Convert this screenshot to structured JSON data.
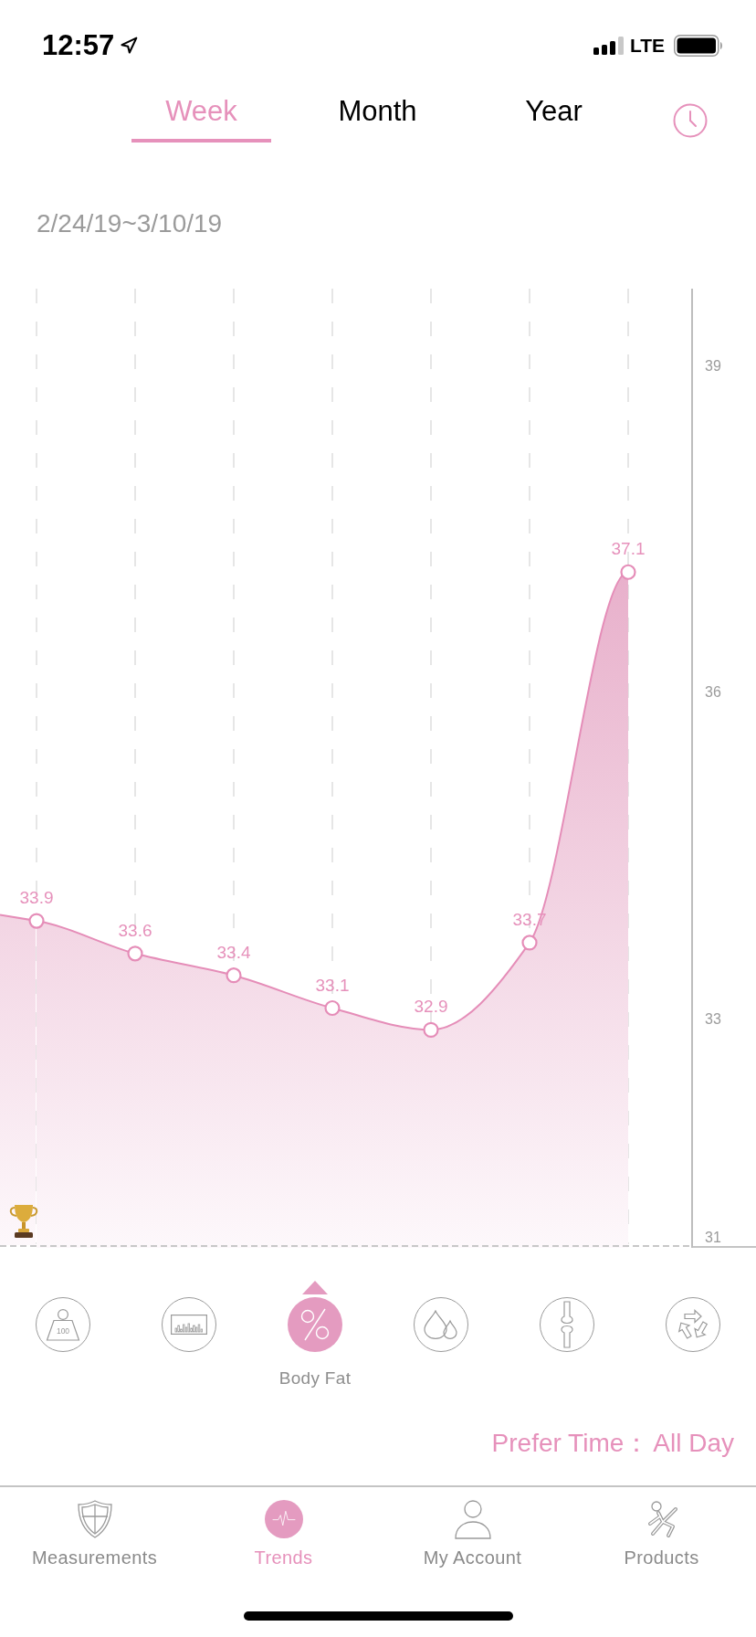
{
  "status_bar": {
    "time": "12:57",
    "network": "LTE"
  },
  "period_tabs": [
    {
      "label": "Week",
      "selected": true
    },
    {
      "label": "Month",
      "selected": false
    },
    {
      "label": "Year",
      "selected": false
    }
  ],
  "date_range": "2/24/19~3/10/19",
  "chart": {
    "chart_data": {
      "type": "area",
      "categories": [
        null,
        null,
        null,
        null,
        null,
        null,
        null
      ],
      "values": [
        33.9,
        33.6,
        33.4,
        33.1,
        32.9,
        33.7,
        37.1
      ],
      "ylim": [
        30.9,
        39.7
      ],
      "yticks": [
        31,
        33,
        36,
        39
      ],
      "grid": true,
      "data_labels": true
    }
  },
  "metrics": [
    {
      "kind": "weight",
      "icon_text": "100",
      "selected": false
    },
    {
      "kind": "bar_graph",
      "selected": false
    },
    {
      "kind": "percent",
      "label": "Body Fat",
      "selected": true
    },
    {
      "kind": "water",
      "selected": false
    },
    {
      "kind": "bone",
      "selected": false
    },
    {
      "kind": "recycle",
      "selected": false
    }
  ],
  "prefer_time": {
    "label": "Prefer Time：",
    "value": "All Day"
  },
  "bottom_tabs": [
    {
      "kind": "shield",
      "label": "Measurements",
      "selected": false
    },
    {
      "kind": "pulse",
      "label": "Trends",
      "selected": true
    },
    {
      "kind": "person",
      "label": "My Account",
      "selected": false
    },
    {
      "kind": "figure",
      "label": "Products",
      "selected": false
    }
  ]
}
